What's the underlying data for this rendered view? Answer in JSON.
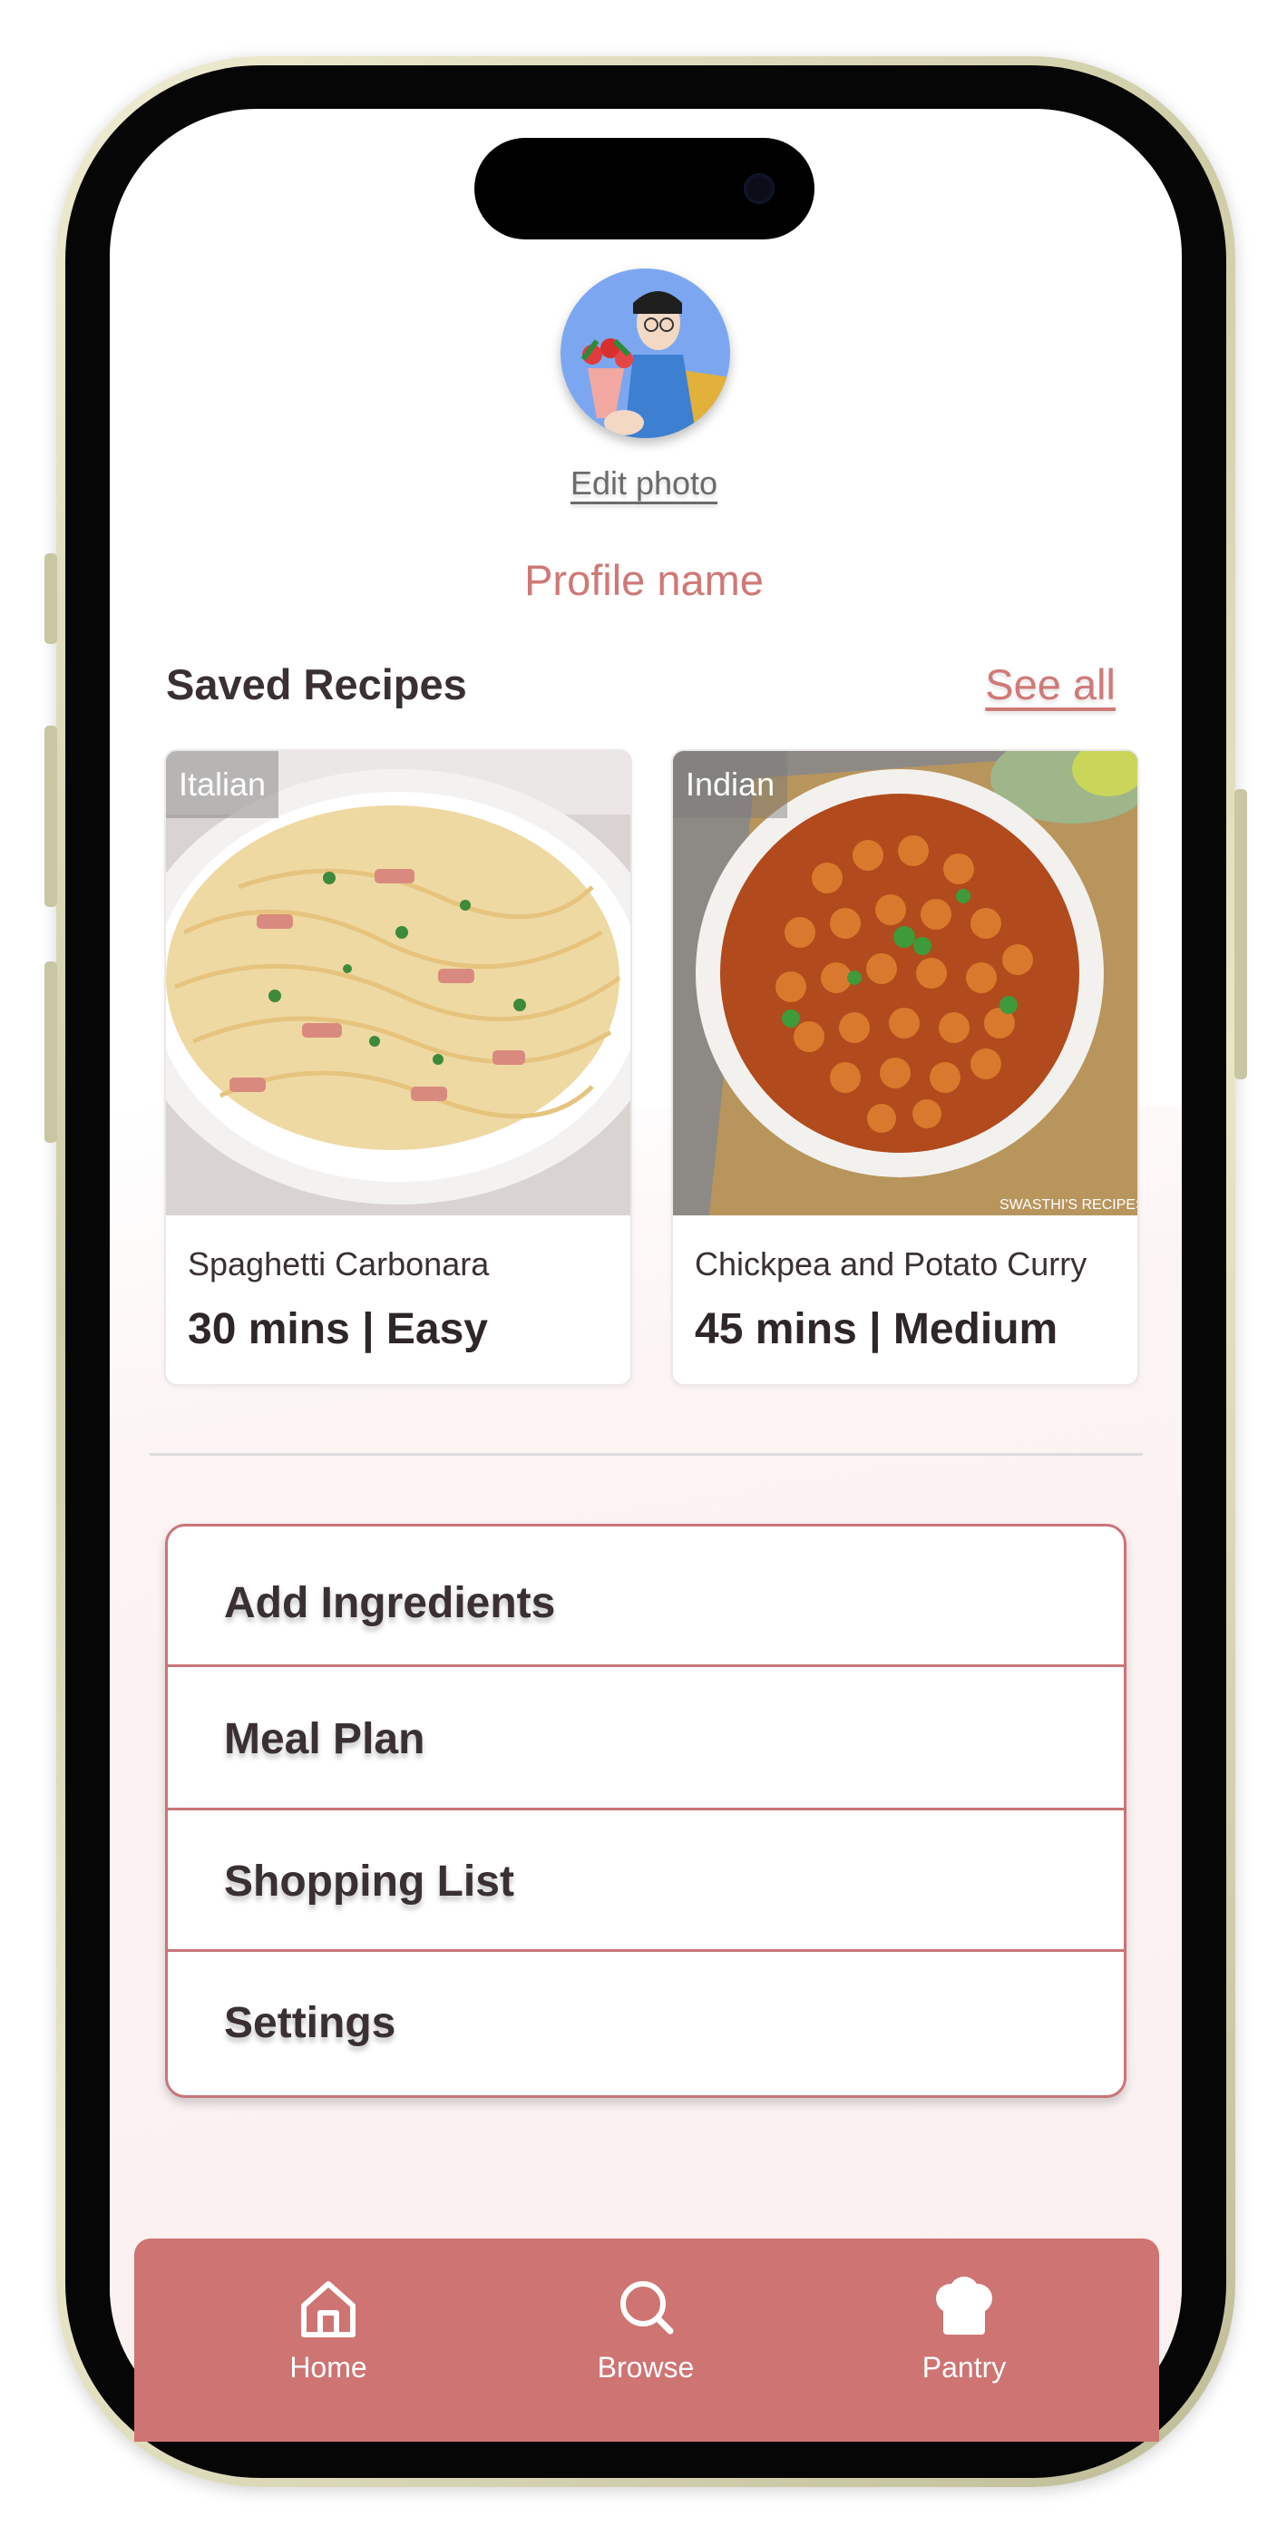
{
  "profile": {
    "edit_photo": "Edit photo",
    "name": "Profile name"
  },
  "saved": {
    "title": "Saved Recipes",
    "see_all": "See all",
    "recipes": [
      {
        "tag": "Italian",
        "name": "Spaghetti Carbonara",
        "meta": "30 mins | Easy"
      },
      {
        "tag": "Indian",
        "name": "Chickpea and Potato Curry",
        "meta": "45 mins | Medium"
      }
    ]
  },
  "menu": {
    "items": [
      "Add Ingredients",
      "Meal Plan",
      "Shopping List",
      "Settings"
    ]
  },
  "tabbar": {
    "home": "Home",
    "browse": "Browse",
    "pantry": "Pantry"
  },
  "colors": {
    "accent": "#ce7473",
    "accent_text": "#d07876",
    "phone_frame": "#e3dfbf"
  }
}
